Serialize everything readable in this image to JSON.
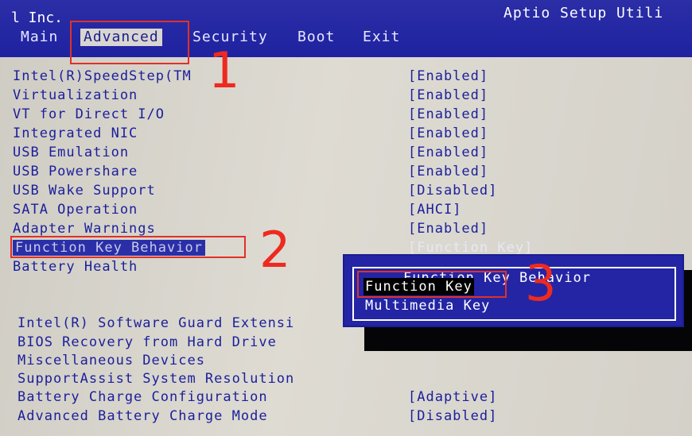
{
  "header": {
    "vendor": "l Inc.",
    "bios_title": "Aptio Setup Utili",
    "tabs": [
      {
        "label": "Main"
      },
      {
        "label": "Advanced",
        "active": true
      },
      {
        "label": "Security"
      },
      {
        "label": "Boot"
      },
      {
        "label": "Exit"
      }
    ]
  },
  "settings": [
    {
      "label": "Intel(R)SpeedStep(TM",
      "value": "[Enabled]"
    },
    {
      "label": "Virtualization",
      "value": "[Enabled]"
    },
    {
      "label": "VT for Direct I/O",
      "value": "[Enabled]"
    },
    {
      "label": "Integrated NIC",
      "value": "[Enabled]"
    },
    {
      "label": "USB Emulation",
      "value": "[Enabled]"
    },
    {
      "label": "USB Powershare",
      "value": "[Enabled]"
    },
    {
      "label": "USB Wake Support",
      "value": "[Disabled]"
    },
    {
      "label": "SATA Operation",
      "value": "[AHCI]"
    },
    {
      "label": "Adapter Warnings",
      "value": "[Enabled]"
    },
    {
      "label": "Function Key Behavior",
      "value": "[Function Key]",
      "selected": true
    },
    {
      "label": "Battery Health",
      "value": ""
    }
  ],
  "lower_settings": [
    {
      "label": "Intel(R) Software Guard Extensi",
      "value": ""
    },
    {
      "label": "BIOS Recovery from Hard Drive",
      "value": ""
    },
    {
      "label": "Miscellaneous Devices",
      "value": ""
    },
    {
      "label": "SupportAssist System Resolution",
      "value": ""
    },
    {
      "label": "Battery Charge Configuration",
      "value": "[Adaptive]"
    },
    {
      "label": "Advanced Battery Charge Mode",
      "value": "[Disabled]"
    }
  ],
  "popup": {
    "title": "Function Key Behavior",
    "options": [
      "Function Key",
      "Multimedia Key"
    ],
    "highlighted": "Function Key"
  },
  "annotations": {
    "step1": "1",
    "step2": "2",
    "step3": "3",
    "color": "#ee2a1f"
  },
  "colors": {
    "header_bg": "#2b2ea6",
    "body_bg": "#dad7cf",
    "text_blue": "#1b1f9a",
    "popup_bg": "#2325a5"
  }
}
